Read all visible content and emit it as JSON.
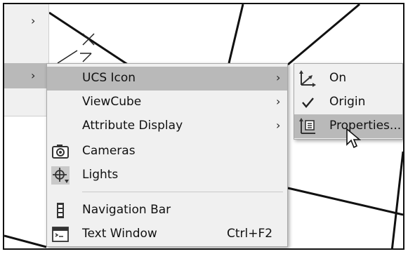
{
  "parent_menu": {
    "top_item_arrow": "›",
    "selected_item_arrow": "›"
  },
  "context_menu": {
    "items": [
      {
        "label": "UCS Icon",
        "arrow": "›",
        "icon": "",
        "highlighted": true
      },
      {
        "label": "ViewCube",
        "arrow": "›",
        "icon": ""
      },
      {
        "label": "Attribute Display",
        "arrow": "›",
        "icon": ""
      },
      {
        "label": "Cameras",
        "icon": "camera-icon"
      },
      {
        "label": "Lights",
        "icon": "lights-icon"
      },
      {
        "label": "Navigation Bar",
        "icon": "navigation-bar-icon"
      },
      {
        "label": "Text Window",
        "shortcut": "Ctrl+F2",
        "icon": "text-window-icon"
      }
    ]
  },
  "ucs_submenu": {
    "items": [
      {
        "label": "On",
        "icon": "ucs-on-icon"
      },
      {
        "label": "Origin",
        "icon": "checkmark-icon",
        "checked": true
      },
      {
        "label": "Properties...",
        "icon": "ucs-properties-icon",
        "highlighted": true
      }
    ]
  },
  "colors": {
    "menu_bg": "#f0f0f0",
    "highlight": "#b9b9b9",
    "text": "#111111"
  }
}
